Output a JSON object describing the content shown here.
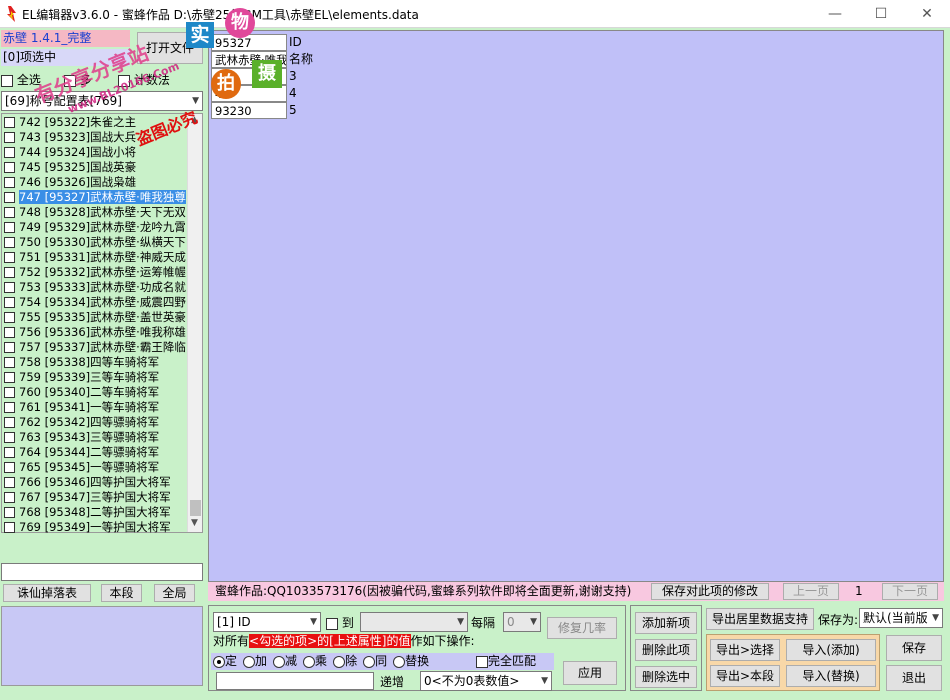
{
  "window": {
    "title": "EL编辑器v3.6.0 - 蜜蜂作品 D:\\赤壁25级GM工具\\赤壁EL\\elements.data",
    "min": "—",
    "max": "☐",
    "close": "✕"
  },
  "left": {
    "version": "赤壁 1.4.1_完整",
    "selected_info": "[0]项选中",
    "open_file": "打开文件",
    "select_all": "全选",
    "cb2": "多",
    "cb3": "计数法",
    "category": "[69]称号配置表[769]",
    "items": [
      {
        "n": "742",
        "id": "[95322]",
        "name": "朱雀之主"
      },
      {
        "n": "743",
        "id": "[95323]",
        "name": "国战大兵"
      },
      {
        "n": "744",
        "id": "[95324]",
        "name": "国战小将"
      },
      {
        "n": "745",
        "id": "[95325]",
        "name": "国战英豪"
      },
      {
        "n": "746",
        "id": "[95326]",
        "name": "国战枭雄"
      },
      {
        "n": "747",
        "id": "[95327]",
        "name": "武林赤壁·唯我独尊",
        "sel": true
      },
      {
        "n": "748",
        "id": "[95328]",
        "name": "武林赤壁·天下无双"
      },
      {
        "n": "749",
        "id": "[95329]",
        "name": "武林赤壁·龙吟九霄"
      },
      {
        "n": "750",
        "id": "[95330]",
        "name": "武林赤壁·纵横天下"
      },
      {
        "n": "751",
        "id": "[95331]",
        "name": "武林赤壁·神威天成"
      },
      {
        "n": "752",
        "id": "[95332]",
        "name": "武林赤壁·运筹帷幄"
      },
      {
        "n": "753",
        "id": "[95333]",
        "name": "武林赤壁·功成名就"
      },
      {
        "n": "754",
        "id": "[95334]",
        "name": "武林赤壁·威震四野"
      },
      {
        "n": "755",
        "id": "[95335]",
        "name": "武林赤壁·盖世英豪"
      },
      {
        "n": "756",
        "id": "[95336]",
        "name": "武林赤壁·唯我称雄"
      },
      {
        "n": "757",
        "id": "[95337]",
        "name": "武林赤壁·霸王降临"
      },
      {
        "n": "758",
        "id": "[95338]",
        "name": "四等车骑将军"
      },
      {
        "n": "759",
        "id": "[95339]",
        "name": "三等车骑将军"
      },
      {
        "n": "760",
        "id": "[95340]",
        "name": "二等车骑将军"
      },
      {
        "n": "761",
        "id": "[95341]",
        "name": "一等车骑将军"
      },
      {
        "n": "762",
        "id": "[95342]",
        "name": "四等骠骑将军"
      },
      {
        "n": "763",
        "id": "[95343]",
        "name": "三等骠骑将军"
      },
      {
        "n": "764",
        "id": "[95344]",
        "name": "二等骠骑将军"
      },
      {
        "n": "765",
        "id": "[95345]",
        "name": "一等骠骑将军"
      },
      {
        "n": "766",
        "id": "[95346]",
        "name": "四等护国大将军"
      },
      {
        "n": "767",
        "id": "[95347]",
        "name": "三等护国大将军"
      },
      {
        "n": "768",
        "id": "[95348]",
        "name": "二等护国大将军"
      },
      {
        "n": "769",
        "id": "[95349]",
        "name": "一等护国大将军"
      }
    ],
    "search_value": "",
    "btn_drop": "诛仙掉落表",
    "btn_section": "本段",
    "btn_all": "全局"
  },
  "fields": [
    {
      "value": "95327",
      "label": "ID"
    },
    {
      "value": "武林赤壁·唯我独尊",
      "label": "名称"
    },
    {
      "value": "3",
      "label": "3"
    },
    {
      "value": "4",
      "label": "4"
    },
    {
      "value": "93230",
      "label": "5"
    }
  ],
  "status": {
    "text": "蜜蜂作品:QQ1033573176(因被骗代码,蜜蜂系列软件即将全面更新,谢谢支持)",
    "save_btn": "保存对此项的修改",
    "prev": "上一页",
    "page": "1",
    "next": "下一页"
  },
  "ops": {
    "field_select": "[1] ID",
    "to_label": "到",
    "interval_label": "每隔",
    "interval_value": "0",
    "repair": "修复几率",
    "desc_pre": "对所有",
    "desc_red": "<勾选的项>的[上述属性]的值",
    "desc_post": "作如下操作:",
    "radios": [
      "定",
      "加",
      "减",
      "乘",
      "除",
      "同",
      "替换"
    ],
    "full_match": "完全匹配",
    "value_input": "",
    "increment": "递增",
    "inc_select": "0<不为0表数值>",
    "apply": "应用"
  },
  "right": {
    "add": "添加新项",
    "delete_item": "删除此项",
    "delete_selected": "删除选中",
    "export_support": "导出居里数据支持",
    "save_as_label": "保存为:",
    "save_as_value": "默认(当前版",
    "export_selection": "导出>选择",
    "import_add": "导入(添加)",
    "export_section": "导出>本段",
    "import_replace": "导入(替换)",
    "save": "保存",
    "exit": "退出"
  },
  "watermark": {
    "a": "实",
    "b": "物",
    "c": "拍",
    "d": "摄",
    "e": "有分享分享站",
    "f": "www.BL20166.Com",
    "g": "盗图必究"
  }
}
